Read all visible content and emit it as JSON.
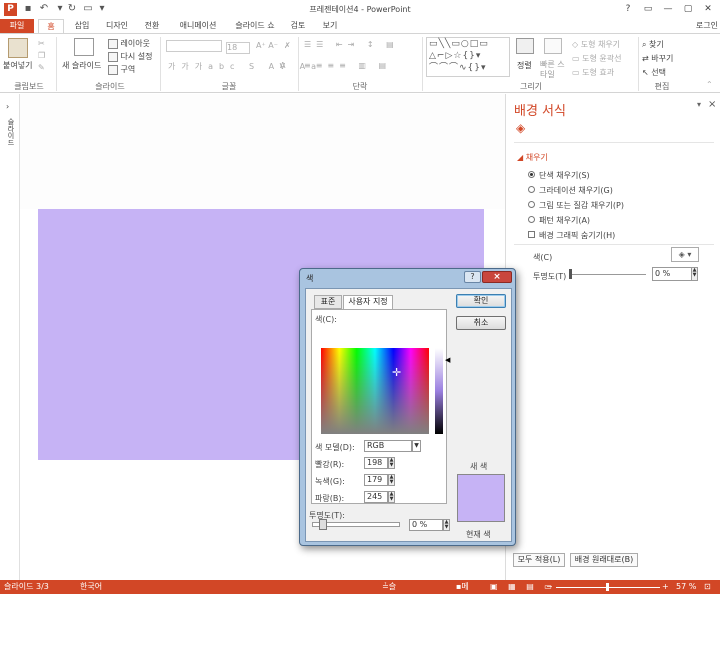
{
  "titlebar": {
    "title": "프레젠테이션4 - PowerPoint",
    "logo": "P",
    "window_controls": [
      "?",
      "▭",
      "—",
      "▢",
      "✕"
    ]
  },
  "tabs": [
    {
      "label": "파일"
    },
    {
      "label": "홈"
    },
    {
      "label": "삽입"
    },
    {
      "label": "디자인"
    },
    {
      "label": "전환"
    },
    {
      "label": "애니메이션"
    },
    {
      "label": "슬라이드 쇼"
    },
    {
      "label": "검토"
    },
    {
      "label": "보기"
    }
  ],
  "login": "로그인",
  "ribbon": {
    "groups": [
      "클립보드",
      "슬라이드",
      "글꼴",
      "단락",
      "그리기",
      "편집"
    ],
    "paste": "붙여넣기",
    "new_slide": "새 슬라이드",
    "layout": "레이아웃",
    "reset": "다시 설정",
    "section": "구역",
    "font_size": "18",
    "arrange": "정렬",
    "quick_styles": "빠른 스타일",
    "shape_fill": "도형 채우기",
    "shape_outline": "도형 윤곽선",
    "shape_effects": "도형 효과",
    "find": "찾기",
    "replace": "바꾸기",
    "select": "선택"
  },
  "thumb_label": "슬라이드",
  "pane": {
    "title": "배경 서식",
    "section": "채우기",
    "options": [
      {
        "label": "단색 채우기(S)",
        "selected": true
      },
      {
        "label": "그라데이션 채우기(G)",
        "selected": false
      },
      {
        "label": "그림 또는 질감 채우기(P)",
        "selected": false
      },
      {
        "label": "패턴 채우기(A)",
        "selected": false
      }
    ],
    "hide_bg": "배경 그래픽 숨기기(H)",
    "color_label": "색(C)",
    "transparency_label": "투명도(T)",
    "transparency_value": "0 %",
    "apply_all": "모두 적용(L)",
    "reset_bg": "배경 원래대로(B)"
  },
  "dialog": {
    "title": "색",
    "help": "?",
    "tabs": [
      "표준",
      "사용자 지정"
    ],
    "ok": "확인",
    "cancel": "취소",
    "colors_label": "색(C):",
    "model_label": "색 모델(D):",
    "model_value": "RGB",
    "red_label": "빨강(R):",
    "red": "198",
    "green_label": "녹색(G):",
    "green": "179",
    "blue_label": "파랑(B):",
    "blue": "245",
    "transparency_label": "투명도(T):",
    "transparency_value": "0 %",
    "new_label": "새 색",
    "current_label": "현재 색"
  },
  "status": {
    "slide": "슬라이드 3/3",
    "lang": "한국어",
    "notes": "슬라이드 노트",
    "comments": "메모",
    "zoom": "57 %"
  },
  "colors": {
    "accent": "#d24726",
    "slide_bg": "#c6b3f5",
    "new_color": "#c6b3f5"
  }
}
